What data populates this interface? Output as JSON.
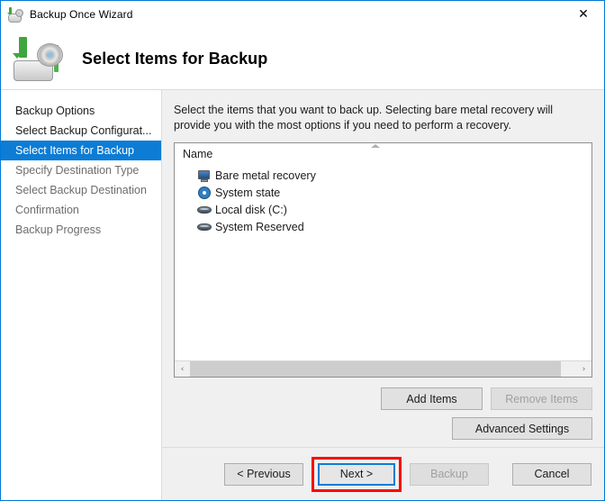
{
  "window": {
    "title": "Backup Once Wizard",
    "title_icon": "backup-disc-icon",
    "close_label": "✕",
    "accent_color": "#0078d7"
  },
  "header": {
    "icon": "backup-disc-drive-icon",
    "title": "Select Items for Backup"
  },
  "sidebar": {
    "items": [
      {
        "label": "Backup Options",
        "state": "done"
      },
      {
        "label": "Select Backup Configurat...",
        "state": "done"
      },
      {
        "label": "Select Items for Backup",
        "state": "selected"
      },
      {
        "label": "Specify Destination Type",
        "state": "pending"
      },
      {
        "label": "Select Backup Destination",
        "state": "pending"
      },
      {
        "label": "Confirmation",
        "state": "pending"
      },
      {
        "label": "Backup Progress",
        "state": "pending"
      }
    ],
    "selected_bg": "#0c7cd5"
  },
  "main": {
    "instructions": "Select the items that you want to back up. Selecting bare metal recovery will provide you with the most options if you need to perform a recovery.",
    "list": {
      "column_header": "Name",
      "sort_indicator": "ascending",
      "rows": [
        {
          "label": "Bare metal recovery",
          "icon": "computer-monitor-icon"
        },
        {
          "label": "System state",
          "icon": "system-state-gear-icon"
        },
        {
          "label": "Local disk (C:)",
          "icon": "disk-drive-icon"
        },
        {
          "label": "System Reserved",
          "icon": "disk-drive-icon"
        }
      ],
      "hscroll": {
        "left_arrow": "‹",
        "right_arrow": "›"
      }
    },
    "buttons": {
      "add_items": "Add Items",
      "remove_items": "Remove Items",
      "remove_items_enabled": false,
      "advanced_settings": "Advanced Settings"
    }
  },
  "footer": {
    "previous": "< Previous",
    "next": "Next >",
    "backup": "Backup",
    "backup_enabled": false,
    "cancel": "Cancel",
    "highlight": {
      "target": "next",
      "outline_color": "#ff0000",
      "focus_color": "#0c7cd5"
    }
  }
}
